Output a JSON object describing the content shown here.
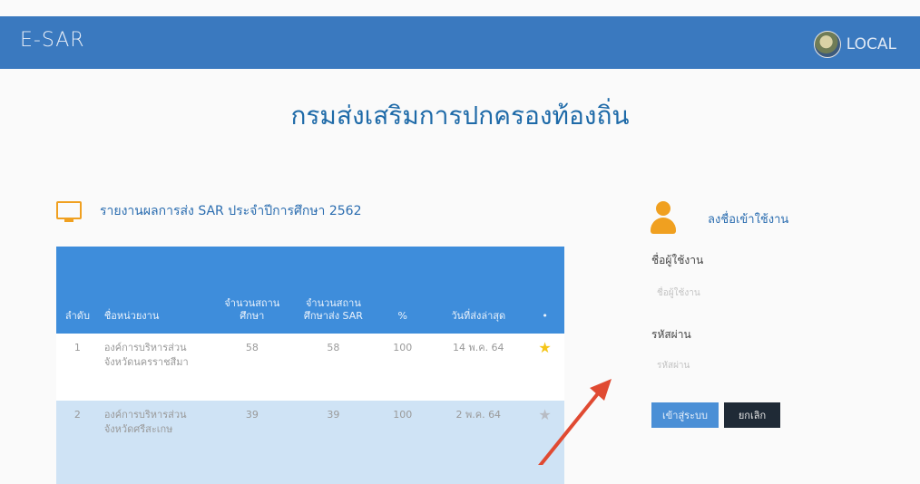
{
  "header": {
    "brand": "E-SAR",
    "local_label": "LOCAL"
  },
  "page": {
    "title": "กรมส่งเสริมการปกครองท้องถิ่น"
  },
  "report": {
    "title": "รายงานผลการส่ง SAR ประจำปีการศึกษา 2562",
    "columns": [
      "ลำดับ",
      "ชื่อหน่วยงาน",
      "จำนวนสถานศึกษา",
      "จำนวนสถานศึกษาส่ง SAR",
      "%",
      "วันที่ส่งล่าสุด",
      "•"
    ],
    "rows": [
      {
        "no": "1",
        "agency": "องค์การบริหารส่วนจังหวัดนครราชสีมา",
        "schools": "58",
        "submitted": "58",
        "percent": "100",
        "last_date": "14 พ.ค. 64",
        "star": "★"
      },
      {
        "no": "2",
        "agency": "องค์การบริหารส่วนจังหวัดศรีสะเกษ",
        "schools": "39",
        "submitted": "39",
        "percent": "100",
        "last_date": "2 พ.ค. 64",
        "star": "★"
      }
    ]
  },
  "login": {
    "title": "ลงชื่อเข้าใช้งาน",
    "username_label": "ชื่อผู้ใช้งาน",
    "username_placeholder": "ชื่อผู้ใช้งาน",
    "password_label": "รหัสผ่าน",
    "password_placeholder": "รหัสผ่าน",
    "login_button": "เข้าสู่ระบบ",
    "cancel_button": "ยกเลิก"
  },
  "colors": {
    "header_bg": "#3a79bf",
    "title": "#1e6aa8",
    "table_header": "#3e8ddb",
    "accent_orange": "#f0a020",
    "arrow": "#e04a32"
  },
  "icons": [
    "monitor-icon",
    "user-icon",
    "star-icon",
    "local-logo"
  ]
}
